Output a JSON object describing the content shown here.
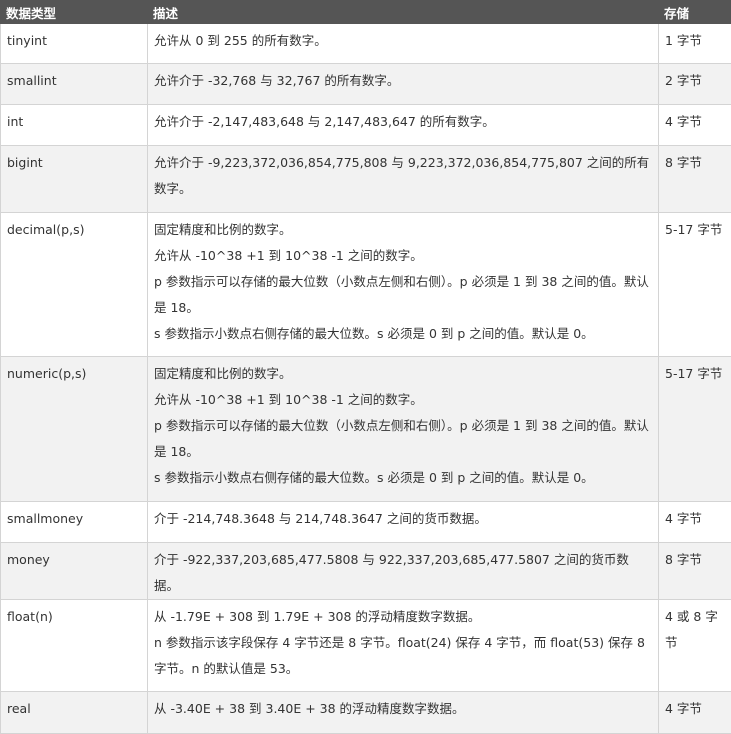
{
  "header": {
    "col_type": "数据类型",
    "col_desc": "描述",
    "col_storage": "存储"
  },
  "rows": [
    {
      "type": "tinyint",
      "desc": [
        "允许从 0 到 255 的所有数字。"
      ],
      "storage": "1 字节"
    },
    {
      "type": "smallint",
      "desc": [
        "允许介于 -32,768 与 32,767 的所有数字。"
      ],
      "storage": "2 字节"
    },
    {
      "type": "int",
      "desc": [
        "允许介于 -2,147,483,648 与 2,147,483,647 的所有数字。"
      ],
      "storage": "4 字节"
    },
    {
      "type": "bigint",
      "desc": [
        "允许介于 -9,223,372,036,854,775,808 与 9,223,372,036,854,775,807 之间的所有数字。"
      ],
      "storage": "8 字节"
    },
    {
      "type": "decimal(p,s)",
      "desc": [
        "固定精度和比例的数字。",
        "允许从 -10^38 +1 到 10^38 -1 之间的数字。",
        "p 参数指示可以存储的最大位数（小数点左侧和右侧）。p 必须是 1 到 38 之间的值。默认是 18。",
        "s 参数指示小数点右侧存储的最大位数。s 必须是 0 到 p 之间的值。默认是 0。"
      ],
      "storage": "5-17 字节"
    },
    {
      "type": "numeric(p,s)",
      "desc": [
        "固定精度和比例的数字。",
        "允许从 -10^38 +1 到 10^38 -1 之间的数字。",
        "p 参数指示可以存储的最大位数（小数点左侧和右侧）。p 必须是 1 到 38 之间的值。默认是 18。",
        "s 参数指示小数点右侧存储的最大位数。s 必须是 0 到 p 之间的值。默认是 0。"
      ],
      "storage": "5-17 字节"
    },
    {
      "type": "smallmoney",
      "desc": [
        "介于 -214,748.3648 与 214,748.3647 之间的货币数据。"
      ],
      "storage": "4 字节"
    },
    {
      "type": "money",
      "desc": [
        "介于 -922,337,203,685,477.5808 与 922,337,203,685,477.5807 之间的货币数据。"
      ],
      "storage": "8 字节"
    },
    {
      "type": "float(n)",
      "desc": [
        "从 -1.79E + 308 到 1.79E + 308 的浮动精度数字数据。",
        "n 参数指示该字段保存 4 字节还是 8 字节。float(24) 保存 4 字节，而 float(53) 保存 8 字节。n 的默认值是 53。"
      ],
      "storage": "4 或 8 字节"
    },
    {
      "type": "real",
      "desc": [
        "从 -3.40E + 38 到 3.40E + 38 的浮动精度数字数据。"
      ],
      "storage": "4 字节"
    }
  ]
}
